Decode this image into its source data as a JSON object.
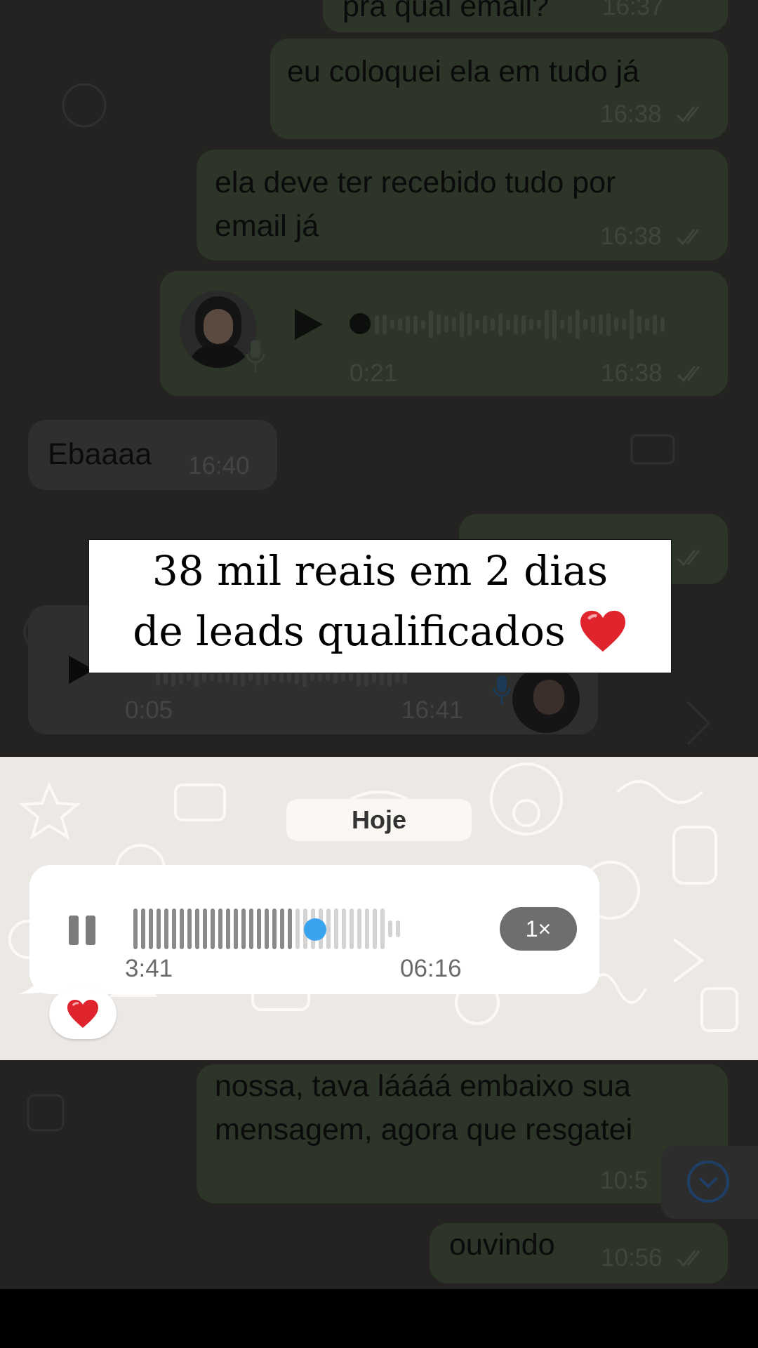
{
  "chat": {
    "top_partial_text": "pra qual email?",
    "top_partial_time": "16:37",
    "msg1_text": "eu coloquei ela em tudo já",
    "msg1_time": "16:38",
    "msg2_line1": "ela deve ter recebido tudo por",
    "msg2_line2": "email já",
    "msg2_time": "16:38",
    "voice1_duration": "0:21",
    "voice1_time": "16:38",
    "msg3_text": "Ebaaaa",
    "msg3_time": "16:40",
    "voice2_duration": "0:05",
    "voice2_time": "16:41",
    "msg5_line1": "nossa, tava láááá embaixo sua",
    "msg5_line2": "mensagem, agora que resgatei",
    "msg5_time": "10:5",
    "msg6_text": "ouvindo",
    "msg6_time": "10:56"
  },
  "overlay": {
    "line1": "38 mil reais em 2 dias",
    "line2": "de leads qualificados"
  },
  "focus": {
    "date_chip": "Hoje",
    "elapsed": "3:41",
    "total": "06:16",
    "speed": "1×",
    "playback_progress": 0.59,
    "reaction": "heart"
  },
  "colors": {
    "dim_background": "#242321",
    "outgoing_bubble_dim": "#2c3527",
    "progress_dot": "#3aa3f0",
    "strip_background": "#ece9e5"
  },
  "icons": [
    "play-icon",
    "pause-icon",
    "mic-icon",
    "read-ticks-icon",
    "heart-icon",
    "chevron-down-icon"
  ]
}
